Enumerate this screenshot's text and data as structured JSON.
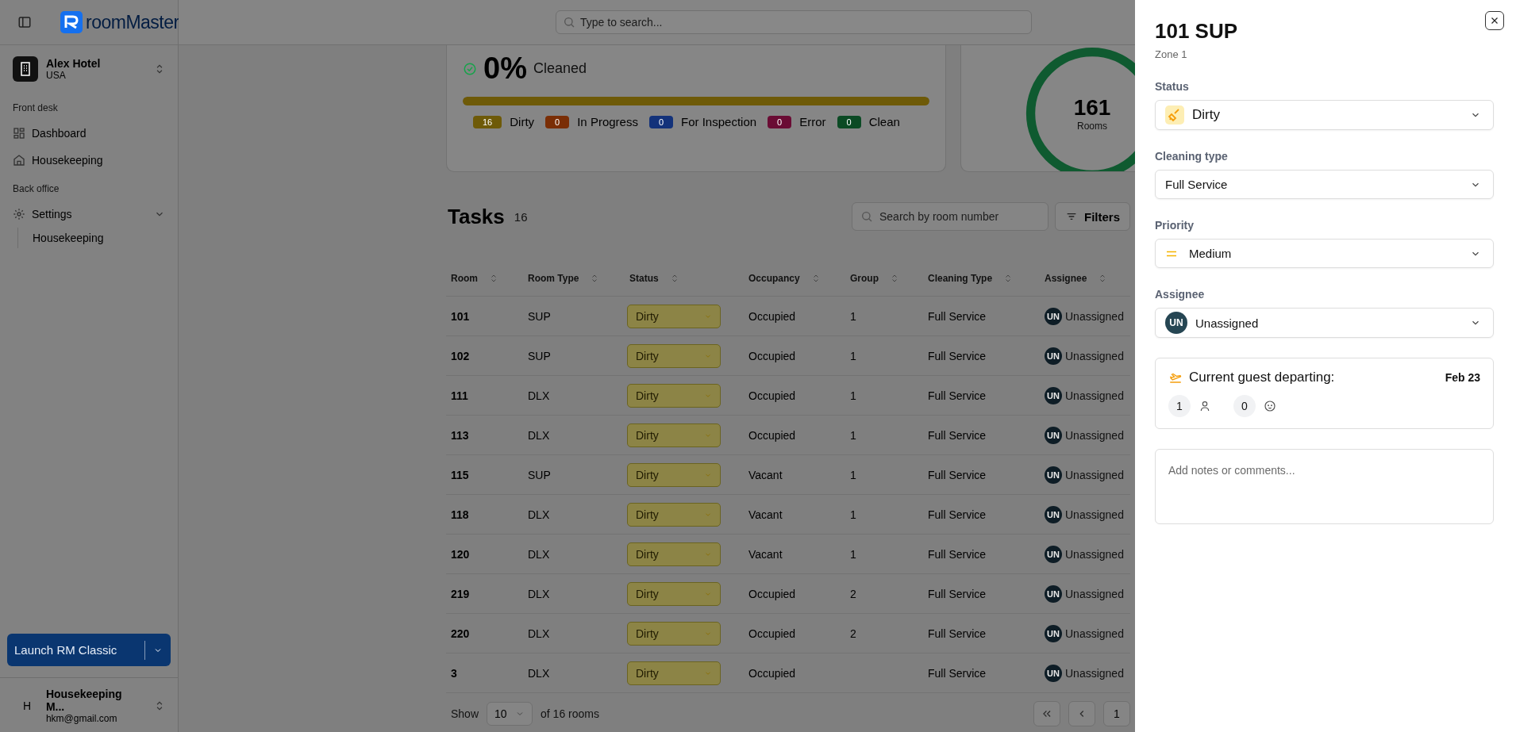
{
  "sidebar": {
    "logo": "roomMaster",
    "property": {
      "name": "Alex Hotel",
      "country": "USA"
    },
    "sections": [
      {
        "title": "Front desk",
        "items": [
          {
            "label": "Dashboard",
            "kind": "grid"
          },
          {
            "label": "Housekeeping",
            "kind": "home"
          }
        ]
      },
      {
        "title": "Back office",
        "items": [
          {
            "label": "Settings",
            "kind": "gear",
            "expanded": true,
            "children": [
              {
                "label": "Housekeeping"
              }
            ]
          }
        ]
      }
    ],
    "launch_button": "Launch RM Classic",
    "user": {
      "initial": "H",
      "name": "Housekeeping M...",
      "email": "hkm@gmail.com"
    }
  },
  "header": {
    "search": {
      "placeholder": "Type to search..."
    }
  },
  "summary": {
    "percent": "0%",
    "label": "Cleaned",
    "progress": {
      "level": 1
    },
    "legend": [
      {
        "count": "16",
        "label": "Dirty",
        "color": "#6e5a08"
      },
      {
        "count": "0",
        "label": "In Progress",
        "color": "#7a2e06"
      },
      {
        "count": "0",
        "label": "For Inspection",
        "color": "#13327a"
      },
      {
        "count": "0",
        "label": "Error",
        "color": "#6a0c34"
      },
      {
        "count": "0",
        "label": "Clean",
        "color": "#0b4a24"
      }
    ]
  },
  "rooms": {
    "count": "161",
    "label": "Rooms"
  },
  "tasks": {
    "title": "Tasks",
    "count": "16",
    "search": {
      "placeholder": "Search by room number"
    },
    "filters_button": "Filters",
    "columns": [
      "Room",
      "Room Type",
      "Status",
      "Occupancy",
      "Group",
      "Cleaning Type",
      "Assignee"
    ],
    "rows": [
      {
        "room": "101",
        "room_type": "SUP",
        "status": "Dirty",
        "color": "#8c8446",
        "occupancy": "Occupied",
        "group": "1",
        "cleaning_type": "Full Service",
        "initials": "UN",
        "assignee": "Unassigned"
      },
      {
        "room": "102",
        "room_type": "SUP",
        "status": "Dirty",
        "color": "#8c8446",
        "occupancy": "Occupied",
        "group": "1",
        "cleaning_type": "Full Service",
        "initials": "UN",
        "assignee": "Unassigned"
      },
      {
        "room": "111",
        "room_type": "DLX",
        "status": "Dirty",
        "color": "#8c8446",
        "occupancy": "Occupied",
        "group": "1",
        "cleaning_type": "Full Service",
        "initials": "UN",
        "assignee": "Unassigned"
      },
      {
        "room": "113",
        "room_type": "DLX",
        "status": "Dirty",
        "color": "#8c8446",
        "occupancy": "Occupied",
        "group": "1",
        "cleaning_type": "Full Service",
        "initials": "UN",
        "assignee": "Unassigned"
      },
      {
        "room": "115",
        "room_type": "SUP",
        "status": "Dirty",
        "color": "#8c8446",
        "occupancy": "Vacant",
        "group": "1",
        "cleaning_type": "Full Service",
        "initials": "UN",
        "assignee": "Unassigned"
      },
      {
        "room": "118",
        "room_type": "DLX",
        "status": "Dirty",
        "color": "#8c8446",
        "occupancy": "Vacant",
        "group": "1",
        "cleaning_type": "Full Service",
        "initials": "UN",
        "assignee": "Unassigned"
      },
      {
        "room": "120",
        "room_type": "DLX",
        "status": "Dirty",
        "color": "#8c8446",
        "occupancy": "Vacant",
        "group": "1",
        "cleaning_type": "Full Service",
        "initials": "UN",
        "assignee": "Unassigned"
      },
      {
        "room": "219",
        "room_type": "DLX",
        "status": "Dirty",
        "color": "#8c8446",
        "occupancy": "Occupied",
        "group": "2",
        "cleaning_type": "Full Service",
        "initials": "UN",
        "assignee": "Unassigned"
      },
      {
        "room": "220",
        "room_type": "DLX",
        "status": "Dirty",
        "color": "#8c8446",
        "occupancy": "Occupied",
        "group": "2",
        "cleaning_type": "Full Service",
        "initials": "UN",
        "assignee": "Unassigned"
      },
      {
        "room": "3",
        "room_type": "DLX",
        "status": "Dirty",
        "color": "#8c8446",
        "occupancy": "Occupied",
        "cleaning_type": "Full Service",
        "initials": "UN",
        "assignee": "Unassigned"
      }
    ],
    "footer": {
      "show_label": "Show",
      "page_size": "10",
      "total": "of 16 rooms",
      "current_page": "1"
    }
  },
  "drawer": {
    "title": "101 SUP",
    "subtitle": "Zone 1",
    "fields": [
      {
        "kind": "status",
        "label": "Status",
        "value": "Dirty"
      },
      {
        "kind": "plain",
        "label": "Cleaning type",
        "value": "Full Service"
      },
      {
        "kind": "priority",
        "label": "Priority",
        "value": "Medium"
      },
      {
        "kind": "assignee",
        "label": "Assignee",
        "initials": "UN",
        "value": "Unassigned"
      }
    ],
    "departure": {
      "label": "Current guest departing:",
      "date": "Feb 23",
      "adults": "1",
      "children": "0"
    },
    "notes": {
      "placeholder": "Add notes or comments..."
    }
  }
}
